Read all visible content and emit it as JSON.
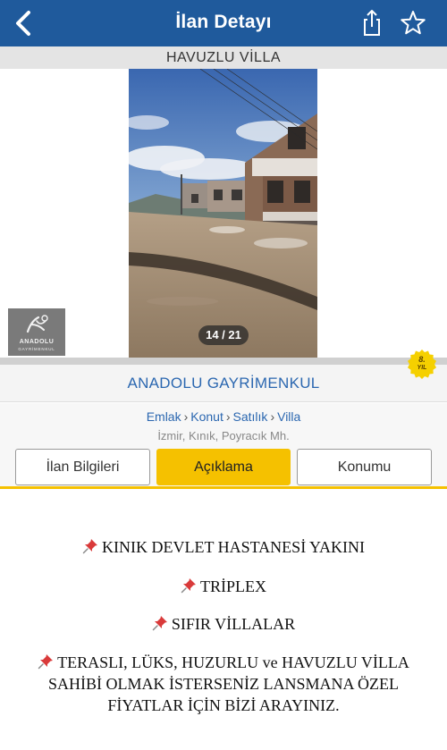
{
  "nav": {
    "title": "İlan Detayı",
    "back_icon": "chevron-left-icon",
    "share_icon": "share-icon",
    "favorite_icon": "star-outline-icon"
  },
  "listing": {
    "title": "HAVUZLU VİLLA"
  },
  "gallery": {
    "counter": "14 / 21",
    "logo_name": "ANADOLU",
    "logo_subtitle": "GAYRİMENKUL"
  },
  "badge": {
    "number": "8.",
    "label": "YIL",
    "color": "#f5d000"
  },
  "agency": {
    "name": "ANADOLU GAYRİMENKUL"
  },
  "breadcrumb": {
    "items": [
      "Emlak",
      "Konut",
      "Satılık",
      "Villa"
    ],
    "separator": "›"
  },
  "location": "İzmir, Kınık, Poyracık Mh.",
  "tabs": [
    {
      "label": "İlan Bilgileri",
      "active": false
    },
    {
      "label": "Açıklama",
      "active": true
    },
    {
      "label": "Konumu",
      "active": false
    }
  ],
  "description": {
    "pin_icon": "pushpin-icon",
    "lines": [
      "KINIK DEVLET HASTANESİ YAKINI",
      "TRİPLEX",
      "SIFIR VİLLALAR",
      "TERASLI, LÜKS, HUZURLU ve HAVUZLU VİLLA",
      "SAHİBİ OLMAK İSTERSENİZ LANSMANA ÖZEL",
      "FİYATLAR İÇİN BİZİ ARAYINIZ."
    ]
  },
  "colors": {
    "nav_bar": "#1f5a9c",
    "accent_tab": "#f5c100",
    "link": "#2b67b0"
  }
}
